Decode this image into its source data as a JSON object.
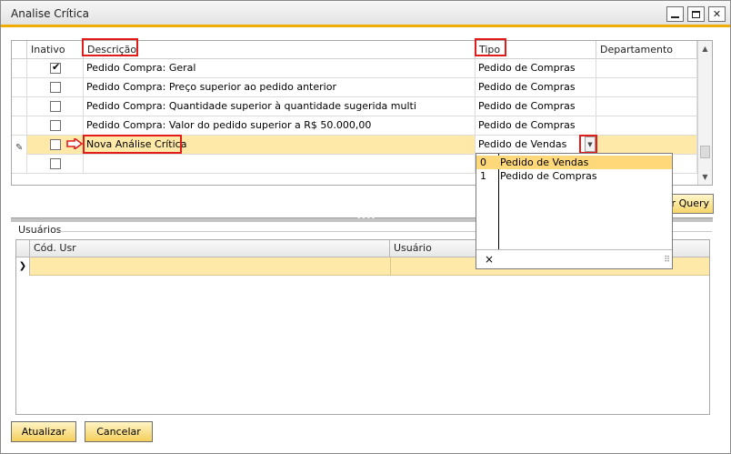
{
  "window": {
    "title": "Analise Crítica"
  },
  "grid_analises": {
    "columns": [
      "Inativo",
      "Descrição",
      "Tipo",
      "Departamento"
    ],
    "rows": [
      {
        "inativo": true,
        "descricao": "Pedido Compra: Geral",
        "tipo": "Pedido de Compras",
        "departamento": ""
      },
      {
        "inativo": false,
        "descricao": "Pedido Compra: Preço superior ao pedido anterior",
        "tipo": "Pedido de Compras",
        "departamento": ""
      },
      {
        "inativo": false,
        "descricao": "Pedido Compra: Quantidade superior à quantidade sugerida multi",
        "tipo": "Pedido de Compras",
        "departamento": ""
      },
      {
        "inativo": false,
        "descricao": "Pedido Compra: Valor do pedido superior a R$ 50.000,00",
        "tipo": "Pedido de Compras",
        "departamento": ""
      },
      {
        "inativo": false,
        "descricao": "Nova Análise Crítica",
        "tipo": "Pedido de Vendas",
        "departamento": ""
      },
      {
        "inativo": false,
        "descricao": "",
        "tipo": "",
        "departamento": ""
      }
    ]
  },
  "tipo_dropdown": {
    "options": [
      {
        "num": "0",
        "label": "Pedido de Vendas",
        "selected": true
      },
      {
        "num": "1",
        "label": "Pedido de Compras",
        "selected": false
      }
    ],
    "close_glyph": "×"
  },
  "query_button": {
    "label": "r Query"
  },
  "usuarios": {
    "group_label": "Usuários",
    "columns": [
      "Cód. Usr",
      "Usuário"
    ]
  },
  "buttons": {
    "atualizar": "Atualizar",
    "cancelar": "Cancelar"
  },
  "colors": {
    "accent": "#f0ad00",
    "active_row": "#ffe9a8",
    "highlight_box": "#e21b1b",
    "selected_option": "#ffd87a"
  }
}
